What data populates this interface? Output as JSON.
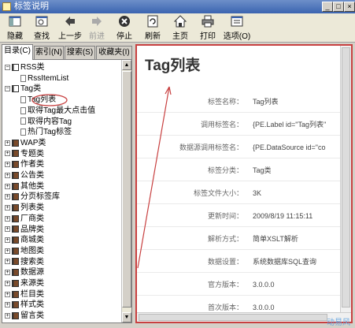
{
  "window": {
    "title": "标签说明"
  },
  "toolbar": [
    {
      "label": "隐藏",
      "icon": "hide-icon",
      "enabled": true
    },
    {
      "label": "查找",
      "icon": "find-icon",
      "enabled": true
    },
    {
      "label": "上一步",
      "icon": "back-icon",
      "enabled": true
    },
    {
      "label": "前进",
      "icon": "forward-icon",
      "enabled": false
    },
    {
      "label": "停止",
      "icon": "stop-icon",
      "enabled": true
    },
    {
      "label": "刷新",
      "icon": "refresh-icon",
      "enabled": true
    },
    {
      "label": "主页",
      "icon": "home-icon",
      "enabled": true
    },
    {
      "label": "打印",
      "icon": "print-icon",
      "enabled": true
    },
    {
      "label": "选项(O)",
      "icon": "options-icon",
      "enabled": true
    }
  ],
  "tabs": [
    "目录(C)",
    "索引(N)",
    "搜索(S)",
    "收藏夹(I)"
  ],
  "tree": [
    {
      "label": "RSS类",
      "type": "book",
      "expanded": true,
      "level": 0
    },
    {
      "label": "RssItemList",
      "type": "page",
      "level": 1
    },
    {
      "label": "Tag类",
      "type": "book",
      "expanded": true,
      "level": 0
    },
    {
      "label": "Tag列表",
      "type": "page",
      "level": 1,
      "selected": true
    },
    {
      "label": "取得Tag最大点击值",
      "type": "page",
      "level": 1
    },
    {
      "label": "取得内容Tag",
      "type": "page",
      "level": 1
    },
    {
      "label": "热门Tag标签",
      "type": "page",
      "level": 1
    },
    {
      "label": "WAP类",
      "type": "book",
      "level": 0
    },
    {
      "label": "专题类",
      "type": "book",
      "level": 0
    },
    {
      "label": "作者类",
      "type": "book",
      "level": 0
    },
    {
      "label": "公告类",
      "type": "book",
      "level": 0
    },
    {
      "label": "其他类",
      "type": "book",
      "level": 0
    },
    {
      "label": "分页标签库",
      "type": "book",
      "level": 0
    },
    {
      "label": "列表类",
      "type": "book",
      "level": 0
    },
    {
      "label": "厂商类",
      "type": "book",
      "level": 0
    },
    {
      "label": "品牌类",
      "type": "book",
      "level": 0
    },
    {
      "label": "商城类",
      "type": "book",
      "level": 0
    },
    {
      "label": "地图类",
      "type": "book",
      "level": 0
    },
    {
      "label": "搜索类",
      "type": "book",
      "level": 0
    },
    {
      "label": "数据源",
      "type": "book",
      "level": 0
    },
    {
      "label": "来源类",
      "type": "book",
      "level": 0
    },
    {
      "label": "栏目类",
      "type": "book",
      "level": 0
    },
    {
      "label": "样式类",
      "type": "book",
      "level": 0
    },
    {
      "label": "留言类",
      "type": "book",
      "level": 0
    }
  ],
  "content": {
    "title": "Tag列表",
    "rows": [
      {
        "key": "标签名称：",
        "value": "Tag列表"
      },
      {
        "key": "调用标签名：",
        "value": "{PE.Label id=\"Tag列表\""
      },
      {
        "key": "数据源调用标签名：",
        "value": "{PE.DataSource id=\"co"
      },
      {
        "key": "标签分类：",
        "value": "Tag类"
      },
      {
        "key": "标签文件大小：",
        "value": "3K"
      },
      {
        "key": "更新时间：",
        "value": "2009/8/19 11:15:11"
      },
      {
        "key": "解析方式：",
        "value": "简单XSLT解析"
      },
      {
        "key": "数据设置：",
        "value": "系统数据库SQL查询"
      },
      {
        "key": "官方版本：",
        "value": "3.0.0.0"
      },
      {
        "key": "首次版本：",
        "value": "3.0.0.0"
      }
    ]
  },
  "watermark": "动易风",
  "colors": {
    "highlight": "#c84040",
    "title_bar": "#3b64b0"
  }
}
